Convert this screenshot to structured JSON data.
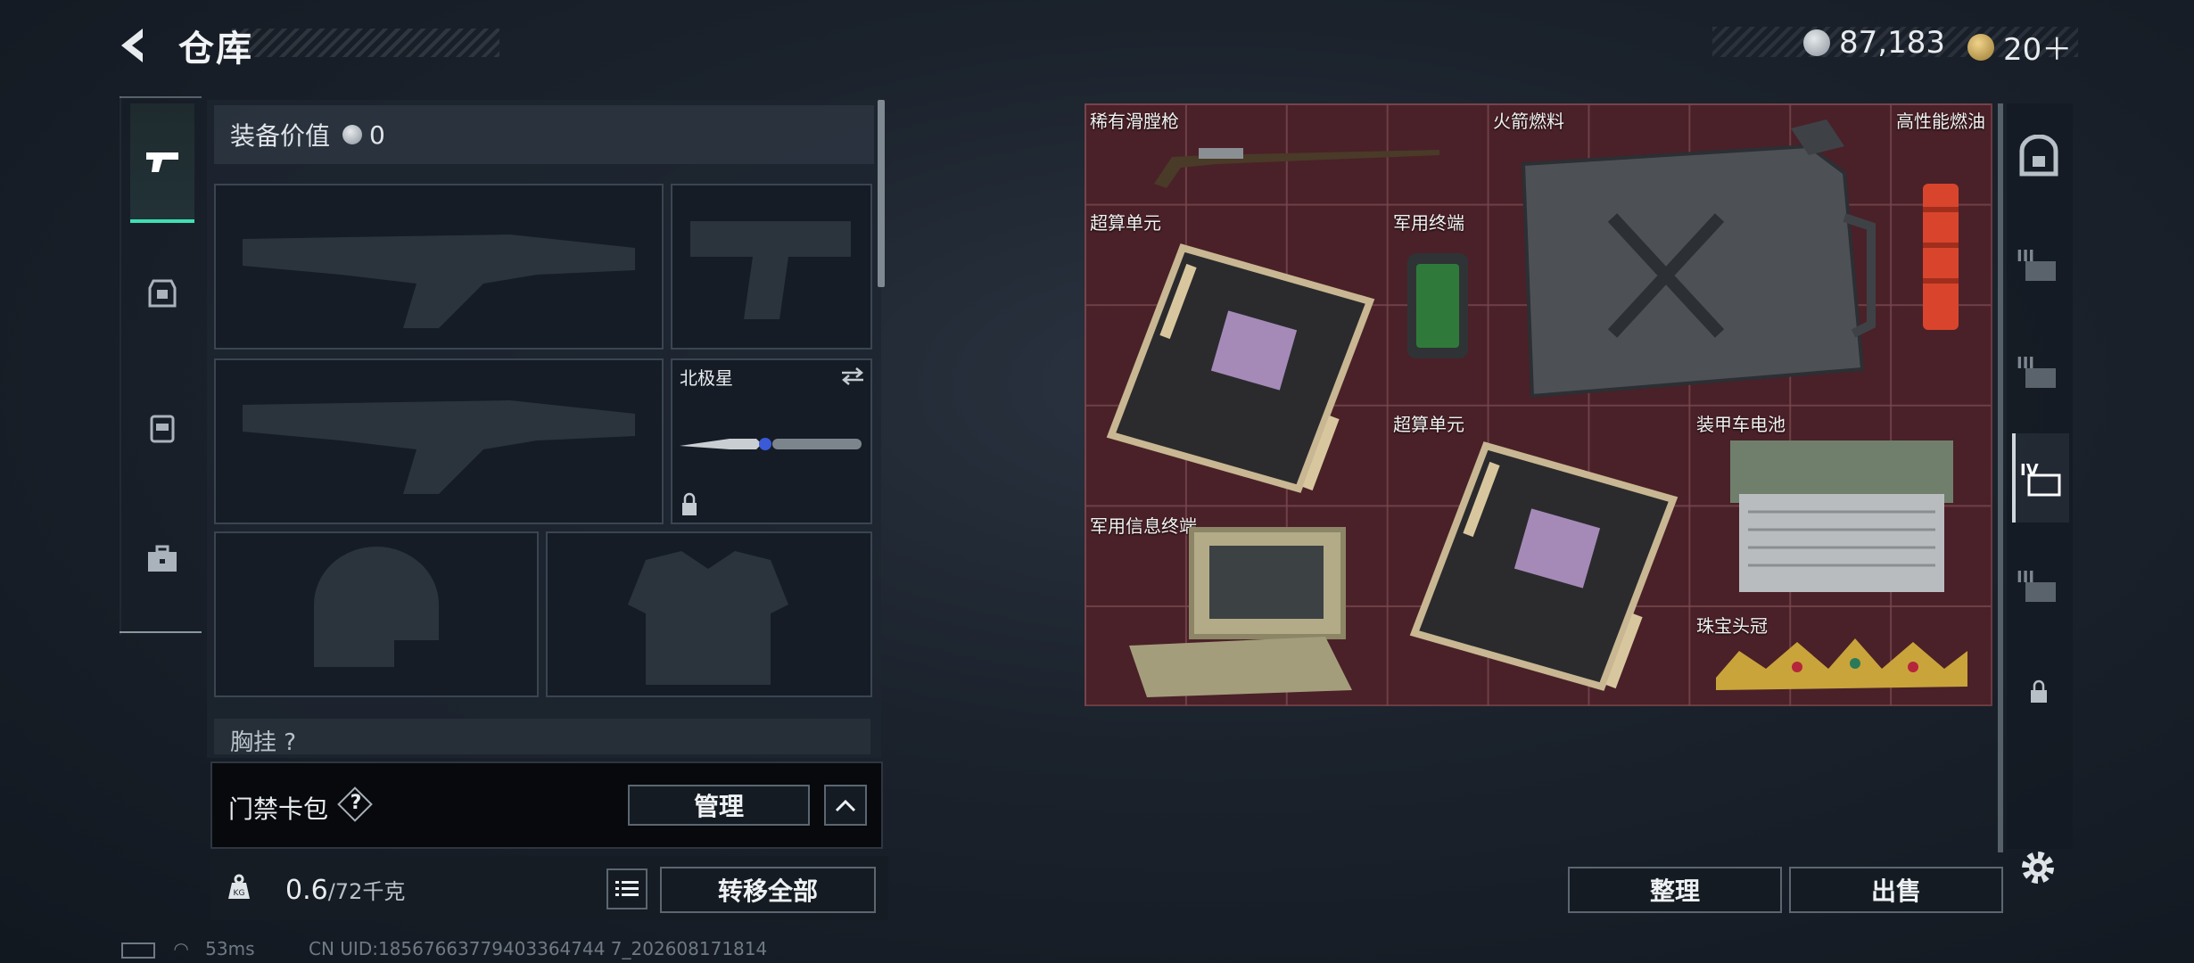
{
  "header": {
    "title": "仓库",
    "back_icon": "back-arrow-icon"
  },
  "currency": [
    {
      "icon": "silver-coin-icon",
      "amount": "87,183"
    },
    {
      "icon": "gold-coin-icon",
      "amount": "20＋"
    }
  ],
  "left_tabs": [
    {
      "icon": "pistol-icon",
      "active": true
    },
    {
      "icon": "rig-icon",
      "active": false
    },
    {
      "icon": "backpack-icon",
      "active": false
    },
    {
      "icon": "briefcase-icon",
      "active": false
    }
  ],
  "equipment": {
    "value_label": "装备价值",
    "value_amount": "0",
    "melee_name": "北极星",
    "chest_label": "胸挂",
    "chest_help": "?"
  },
  "keycard": {
    "label": "门禁卡包",
    "help": "?",
    "manage_button": "管理"
  },
  "capacity": {
    "current": "0.6",
    "max": "/72千克"
  },
  "actions": {
    "transfer_all": "转移全部",
    "sort": "整理",
    "sell": "出售"
  },
  "stash_items": [
    {
      "name": "稀有滑膛枪",
      "icon": "musket-icon"
    },
    {
      "name": "火箭燃料",
      "icon": "fuel-canister-icon"
    },
    {
      "name": "高性能燃油",
      "icon": "fuel-cartridge-icon"
    },
    {
      "name": "超算单元",
      "icon": "supercomputer-board-icon"
    },
    {
      "name": "军用终端",
      "icon": "military-terminal-icon"
    },
    {
      "name": "超算单元",
      "icon": "supercomputer-board-icon"
    },
    {
      "name": "装甲车电池",
      "icon": "vehicle-battery-icon"
    },
    {
      "name": "军用信息终端",
      "icon": "field-laptop-icon"
    },
    {
      "name": "珠宝头冠",
      "icon": "jeweled-crown-icon"
    }
  ],
  "right_tabs": [
    {
      "icon": "safe-box-icon",
      "label": ""
    },
    {
      "icon": "stash-page-icon",
      "label": "III"
    },
    {
      "icon": "stash-page-icon",
      "label": "III"
    },
    {
      "icon": "stash-page-icon",
      "label": "IV",
      "active": true
    },
    {
      "icon": "stash-page-icon",
      "label": "III"
    },
    {
      "icon": "lock-icon",
      "label": ""
    }
  ],
  "status": {
    "ping": "53ms",
    "uid": "CN UID:18567663779403364744 7_202608171814"
  }
}
